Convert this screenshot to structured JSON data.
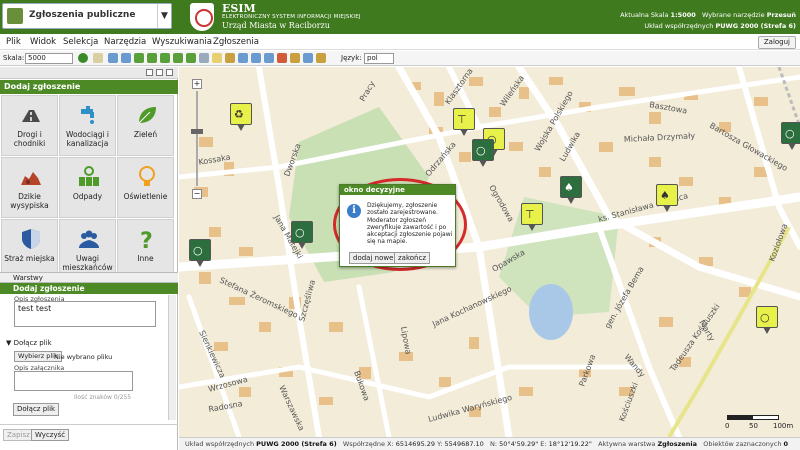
{
  "header": {
    "layer_name": "Zgłoszenia publiczne",
    "brand_title": "ESIM",
    "brand_sub": "ELEKTRONICZNY SYSTEM INFORMACJI MIEJSKIEJ",
    "brand_city": "Urząd Miasta w Raciborzu",
    "scale_label": "Aktualna Skala",
    "scale_value": "1:5000",
    "tool_label": "Wybrane narzędzie",
    "tool_value": "Przesuń",
    "coords_label": "Układ współrzędnych",
    "coords_value": "PUWG 2000 (Strefa 6)"
  },
  "menu": {
    "items": [
      "Plik",
      "Widok",
      "Selekcja",
      "Narzędzia",
      "Wyszukiwania",
      "Zgłoszenia"
    ],
    "login": "Zaloguj"
  },
  "toolbar": {
    "scale_label": "Skala:",
    "scale_value": "5000",
    "lang_label": "Język:",
    "lang_value": "pol"
  },
  "left": {
    "panel_title": "Dodaj zgłoszenie",
    "tiles": [
      {
        "label": "Drogi i chodniki",
        "icon": "road-icon",
        "color": "#4a4a4a"
      },
      {
        "label": "Wodociągi i kanalizacja",
        "icon": "water-tap-icon",
        "color": "#2f8fc7"
      },
      {
        "label": "Zieleń",
        "icon": "leaf-icon",
        "color": "#4f9b2a"
      },
      {
        "label": "Dzikie wysypiska",
        "icon": "dump-icon",
        "color": "#b5452a"
      },
      {
        "label": "Odpady",
        "icon": "recycle-bins-icon",
        "color": "#4f9b2a"
      },
      {
        "label": "Oświetlenie",
        "icon": "lightbulb-icon",
        "color": "#f0a01e"
      },
      {
        "label": "Straż miejska",
        "icon": "shield-icon",
        "color": "#2a5aa0"
      },
      {
        "label": "Uwagi mieszkańców",
        "icon": "people-icon",
        "color": "#2a5aa0"
      },
      {
        "label": "Inne",
        "icon": "question-icon",
        "color": "#4f9b2a"
      }
    ],
    "layers_title": "Warstwy",
    "form_title": "Dodaj zgłoszenie",
    "opis_label": "Opis zgłoszenia",
    "opis_value": "test  test",
    "attach_title": "Dołącz plik",
    "choose_file": "Wybierz plik",
    "no_file": "Nie wybrano pliku",
    "attach_desc_label": "Opis załącznika",
    "char_counter": "Ilość znaków 0/255",
    "attach_button": "Dołącz plik",
    "save_button": "Zapisz",
    "clear_button": "Wyczyść"
  },
  "map": {
    "streets": [
      {
        "label": "Klasztorna"
      },
      {
        "label": "Wileńska"
      },
      {
        "label": "Wojska Polskiego"
      },
      {
        "label": "Basztowa"
      },
      {
        "label": "Bartosza Głowackiego"
      },
      {
        "label": "Michała Drzymały"
      },
      {
        "label": "Odrzańska"
      },
      {
        "label": "Ogrodowa"
      },
      {
        "label": "Ludwika"
      },
      {
        "label": "ks. Stanisława Staszica"
      },
      {
        "label": "Opawska"
      },
      {
        "label": "Dworska"
      },
      {
        "label": "Kossaka"
      },
      {
        "label": "Jana Matejki"
      },
      {
        "label": "Szczęśliwa"
      },
      {
        "label": "Stefana Żeromskiego"
      },
      {
        "label": "Lipowa"
      },
      {
        "label": "Jana Kochanowskiego"
      },
      {
        "label": "Sienkiewicza"
      },
      {
        "label": "Marty"
      },
      {
        "label": "gen. Józefa Bema"
      },
      {
        "label": "Tadeusza Kościuszki"
      },
      {
        "label": "Koziołowa"
      },
      {
        "label": "Wandy"
      },
      {
        "label": "Parkowa"
      },
      {
        "label": "Kościuszki"
      },
      {
        "label": "Bukowa"
      },
      {
        "label": "Warszawska"
      },
      {
        "label": "Wrzosowa"
      },
      {
        "label": "Radosna"
      },
      {
        "label": "Ludwika Waryńskiego"
      },
      {
        "label": "Pracy"
      }
    ],
    "scale_0": "0",
    "scale_50": "50",
    "scale_100": "100m"
  },
  "dialog": {
    "title": "okno decyzyjne",
    "message": "Dziękujemy, zgłoszenie zostało zarejestrowane. Moderator zgłoszeń zweryfikuje zawartość i po akceptacji zgłoszenie pojawi się na mapie.",
    "add_new": "dodaj nowe",
    "finish": "zakończ"
  },
  "status": {
    "coords_label": "Układ współrzędnych",
    "coords_value": "PUWG 2000 (Strefa 6)",
    "xy_label": "Współrzędne X:",
    "x_value": "6514695.29",
    "y_label": "Y:",
    "y_value": "5549687.10",
    "n_label": "N:",
    "n_value": "50°4'59.29\"",
    "e_label": "E:",
    "e_value": "18°12'19.22\"",
    "active_label": "Aktywna warstwa",
    "active_value": "Zgłoszenia",
    "selected_label": "Obiektów zaznaczonych",
    "selected_value": "0"
  },
  "colors": {
    "header_green": "#3f7a1f",
    "panel_green": "#4d8a26",
    "marker_dark": "#2d6e3e",
    "marker_yellow": "#e8f04a",
    "halo_red": "#d42a2a"
  }
}
